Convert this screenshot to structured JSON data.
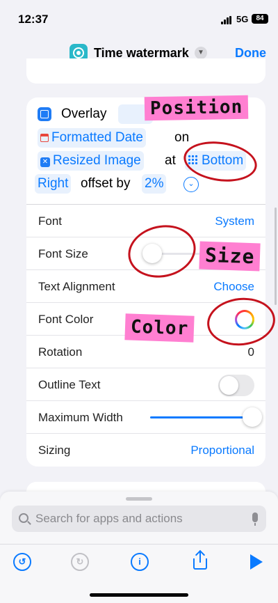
{
  "status_bar": {
    "time": "12:37",
    "network": "5G",
    "battery": "84"
  },
  "nav": {
    "title": "Time watermark",
    "done": "Done"
  },
  "action": {
    "verb": "Overlay",
    "date_var": "Formatted Date",
    "on": "on",
    "image_var": "Resized Image",
    "at": "at",
    "position_a": "Bottom",
    "position_b": "Right",
    "offset_by": "offset by",
    "offset": "2%"
  },
  "settings": [
    {
      "label": "Font",
      "value": "System",
      "kind": "link"
    },
    {
      "label": "Font Size",
      "kind": "slider",
      "level": 0.02
    },
    {
      "label": "Text Alignment",
      "value": "Choose",
      "kind": "link"
    },
    {
      "label": "Font Color",
      "kind": "color"
    },
    {
      "label": "Rotation",
      "value": "0",
      "kind": "text"
    },
    {
      "label": "Outline Text",
      "kind": "toggle",
      "on": false
    },
    {
      "label": "Maximum Width",
      "kind": "slider",
      "level": 0.98
    },
    {
      "label": "Sizing",
      "value": "Proportional",
      "kind": "link"
    }
  ],
  "annotations": {
    "position": "Position",
    "size": "Size",
    "color": "Color"
  },
  "search": {
    "placeholder": "Search for apps and actions"
  },
  "colors": {
    "accent": "#0a7aff",
    "annotation_bg": "#ff7fd1",
    "annotation_ring": "#c5121d",
    "app_icon": "#29b8c9"
  },
  "icons": [
    "signal-icon",
    "battery-icon",
    "shortcut-app-icon",
    "chevron-down-icon",
    "overlay-icon",
    "calendar-icon",
    "image-icon",
    "grid-icon",
    "expand-icon",
    "color-wheel-icon",
    "search-icon",
    "microphone-icon",
    "undo-icon",
    "redo-icon",
    "info-icon",
    "share-icon",
    "play-icon"
  ]
}
